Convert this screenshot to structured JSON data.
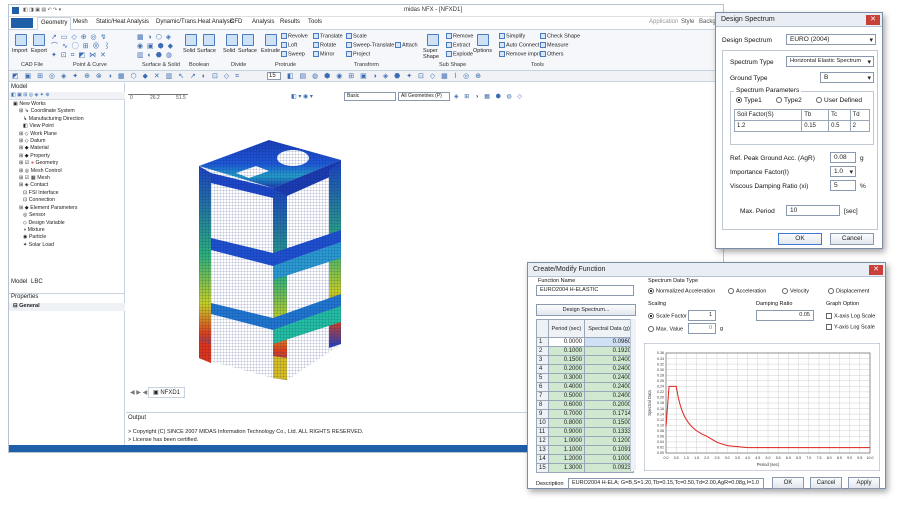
{
  "app": {
    "title": "midas NFX - [NFXD1]",
    "tabs": [
      "Geometry",
      "Mesh",
      "Static/Heat Analysis",
      "Dynamic/Trans.Heat Analysis",
      "CFD",
      "Analysis",
      "Results",
      "Tools"
    ],
    "right_links": [
      "Application",
      "Style",
      "Backg"
    ],
    "ribbon": {
      "cad_file": {
        "group": "CAD File",
        "items": [
          "Import",
          "Export"
        ]
      },
      "point_curve": {
        "group": "Point & Curve"
      },
      "surface_solid": {
        "group": "Surface & Solid"
      },
      "boolean": {
        "group": "Boolean",
        "items": [
          "Solid",
          "Surface"
        ]
      },
      "divide": {
        "group": "Divide",
        "items": [
          "Solid",
          "Surface"
        ]
      },
      "protrude": {
        "group": "Protrude",
        "items": [
          "Extrude",
          "Revolve",
          "Loft",
          "Sweep"
        ]
      },
      "transform": {
        "group": "Transform",
        "items": [
          "Translate",
          "Rotate",
          "Mirror",
          "Scale",
          "Sweep-Translate",
          "Project",
          "Attach"
        ]
      },
      "sub_shape": {
        "group": "Sub Shape",
        "items": [
          "Super Shape",
          "Remove",
          "Extract",
          "Explode"
        ]
      },
      "tools": {
        "group": "Tools",
        "items": [
          "Options",
          "Simplify",
          "Auto Connect",
          "Remove imprint",
          "Check Shape",
          "Measure",
          "Others"
        ]
      }
    },
    "toolbar2": {
      "zoom": "15"
    },
    "model_panel": {
      "title": "Model",
      "tree": [
        "New Works",
        "Coordinate System",
        "Manufacturing Direction",
        "View Point",
        "Work Plane",
        "Datum",
        "Material",
        "Property",
        "Geometry",
        "Mesh Control",
        "Mesh",
        "Contact",
        "FSI Interface",
        "Connection",
        "Element Parameters",
        "Sensor",
        "Design Variable",
        "Mixture",
        "Particle",
        "Solar Load"
      ],
      "bottom_tabs": [
        "Model",
        "LBC"
      ]
    },
    "properties_panel": {
      "title": "Properties",
      "section": "General"
    },
    "view": {
      "combo1": "Basic",
      "combo2": "All Geometries (P)",
      "ruler": [
        "0",
        "26.2",
        "51.5"
      ],
      "doc_tab": "NFXD1",
      "side_label": "An"
    },
    "output": {
      "title": "Output",
      "lines": [
        "> Copyright (C) SINCE 2007 MIDAS Information Technology Co., Ltd. ALL RIGHTS RESERVED.",
        "> License has been certified."
      ]
    }
  },
  "design_spectrum": {
    "title": "Design Spectrum",
    "design_spectrum_label": "Design Spectrum",
    "design_spectrum_value": "EURO (2004)",
    "spectrum_type_label": "Spectrum Type",
    "spectrum_type_value": "Horizontal Elastic Spectrum",
    "ground_type_label": "Ground Type",
    "ground_type_value": "B",
    "params_title": "Spectrum Parameters",
    "radio_labels": [
      "Type1",
      "Type2",
      "User Defined"
    ],
    "table_headers": [
      "Soil Factor(S)",
      "Tb",
      "Tc",
      "Td"
    ],
    "table_values": [
      "1.2",
      "0.15",
      "0.5",
      "2"
    ],
    "agr_label": "Ref. Peak Ground Acc. (AgR)",
    "agr_value": "0.08",
    "agr_unit": "g",
    "importance_label": "Importance Factor(I)",
    "importance_value": "1.0",
    "damping_label": "Viscous Damping Ratio (xi)",
    "damping_value": "5",
    "damping_unit": "%",
    "max_period_label": "Max. Period",
    "max_period_value": "10",
    "max_period_unit": "[sec]",
    "ok_label": "OK",
    "cancel_label": "Cancel"
  },
  "create_function": {
    "title": "Create/Modify Function",
    "function_name_label": "Function Name",
    "function_name_value": "EURO2004 H-ELASTIC",
    "design_spectrum_button": "Design Spectrum...",
    "table_headers": [
      "Period (sec)",
      "Spectral Data (g)"
    ],
    "rows": [
      [
        "1",
        "0.0000",
        "0.0960"
      ],
      [
        "2",
        "0.1000",
        "0.1920"
      ],
      [
        "3",
        "0.1500",
        "0.2400"
      ],
      [
        "4",
        "0.2000",
        "0.2400"
      ],
      [
        "5",
        "0.3000",
        "0.2400"
      ],
      [
        "6",
        "0.4000",
        "0.2400"
      ],
      [
        "7",
        "0.5000",
        "0.2400"
      ],
      [
        "8",
        "0.6000",
        "0.2000"
      ],
      [
        "9",
        "0.7000",
        "0.1714"
      ],
      [
        "10",
        "0.8000",
        "0.1500"
      ],
      [
        "11",
        "0.9000",
        "0.1333"
      ],
      [
        "12",
        "1.0000",
        "0.1200"
      ],
      [
        "13",
        "1.1000",
        "0.1091"
      ],
      [
        "14",
        "1.2000",
        "0.1000"
      ],
      [
        "15",
        "1.3000",
        "0.0923"
      ]
    ],
    "spectrum_data_type_label": "Spectrum Data Type",
    "data_type_options": [
      "Normalized Acceleration",
      "Acceleration",
      "Velocity",
      "Displacement"
    ],
    "scaling_label": "Scaling",
    "scale_factor_label": "Scale Factor",
    "scale_factor_value": "1",
    "max_value_label": "Max. Value",
    "max_value_value": "0",
    "max_value_unit": "g",
    "damping_ratio_label": "Damping Ratio",
    "damping_ratio_value": "0.05",
    "graph_option_label": "Graph Option",
    "graph_options": [
      "X-axis Log Scale",
      "Y-axis Log Scale"
    ],
    "description_label": "Description",
    "description_value": "EURO2004 H-ELA; G=B,S=1.20,Tb=0.15,Tc=0.50,Td=2.00,AgR=0.08g,I=1.0",
    "ok_label": "OK",
    "cancel_label": "Cancel",
    "apply_label": "Apply",
    "chart_labels": {
      "ylabel": "Spectral Data",
      "xlabel": "Period (sec)"
    }
  },
  "chart_data": {
    "type": "line",
    "xlabel": "Period (sec)",
    "ylabel": "Spectral Data",
    "xlim": [
      0,
      10
    ],
    "ylim": [
      0,
      0.36
    ],
    "xticks": [
      "0.0",
      "0.5",
      "1.0",
      "1.5",
      "2.0",
      "2.5",
      "3.0",
      "3.5",
      "4.0",
      "4.5",
      "5.0",
      "5.5",
      "6.0",
      "6.5",
      "7.0",
      "7.5",
      "8.0",
      "8.5",
      "9.0",
      "9.5",
      "10.0"
    ],
    "yticks": [
      "0.00",
      "0.02",
      "0.04",
      "0.06",
      "0.08",
      "0.10",
      "0.12",
      "0.14",
      "0.16",
      "0.18",
      "0.20",
      "0.22",
      "0.24",
      "0.26",
      "0.28",
      "0.30",
      "0.32",
      "0.34",
      "0.36"
    ],
    "grid": true,
    "series": [
      {
        "color": "#e0201a",
        "x": [
          0,
          0.1,
          0.15,
          0.5,
          0.6,
          0.7,
          0.8,
          0.9,
          1.0,
          1.1,
          1.2,
          1.3,
          1.5,
          1.75,
          2.0,
          2.5,
          3.0,
          4.0,
          5.0,
          6.0,
          7.0,
          8.0,
          9.0,
          10.0
        ],
        "y": [
          0.096,
          0.192,
          0.24,
          0.24,
          0.2,
          0.1714,
          0.15,
          0.1333,
          0.12,
          0.1091,
          0.1,
          0.0923,
          0.08,
          0.0686,
          0.06,
          0.0384,
          0.0267,
          0.0192,
          0.0192,
          0.0192,
          0.0192,
          0.0192,
          0.0192,
          0.0192
        ]
      }
    ]
  }
}
